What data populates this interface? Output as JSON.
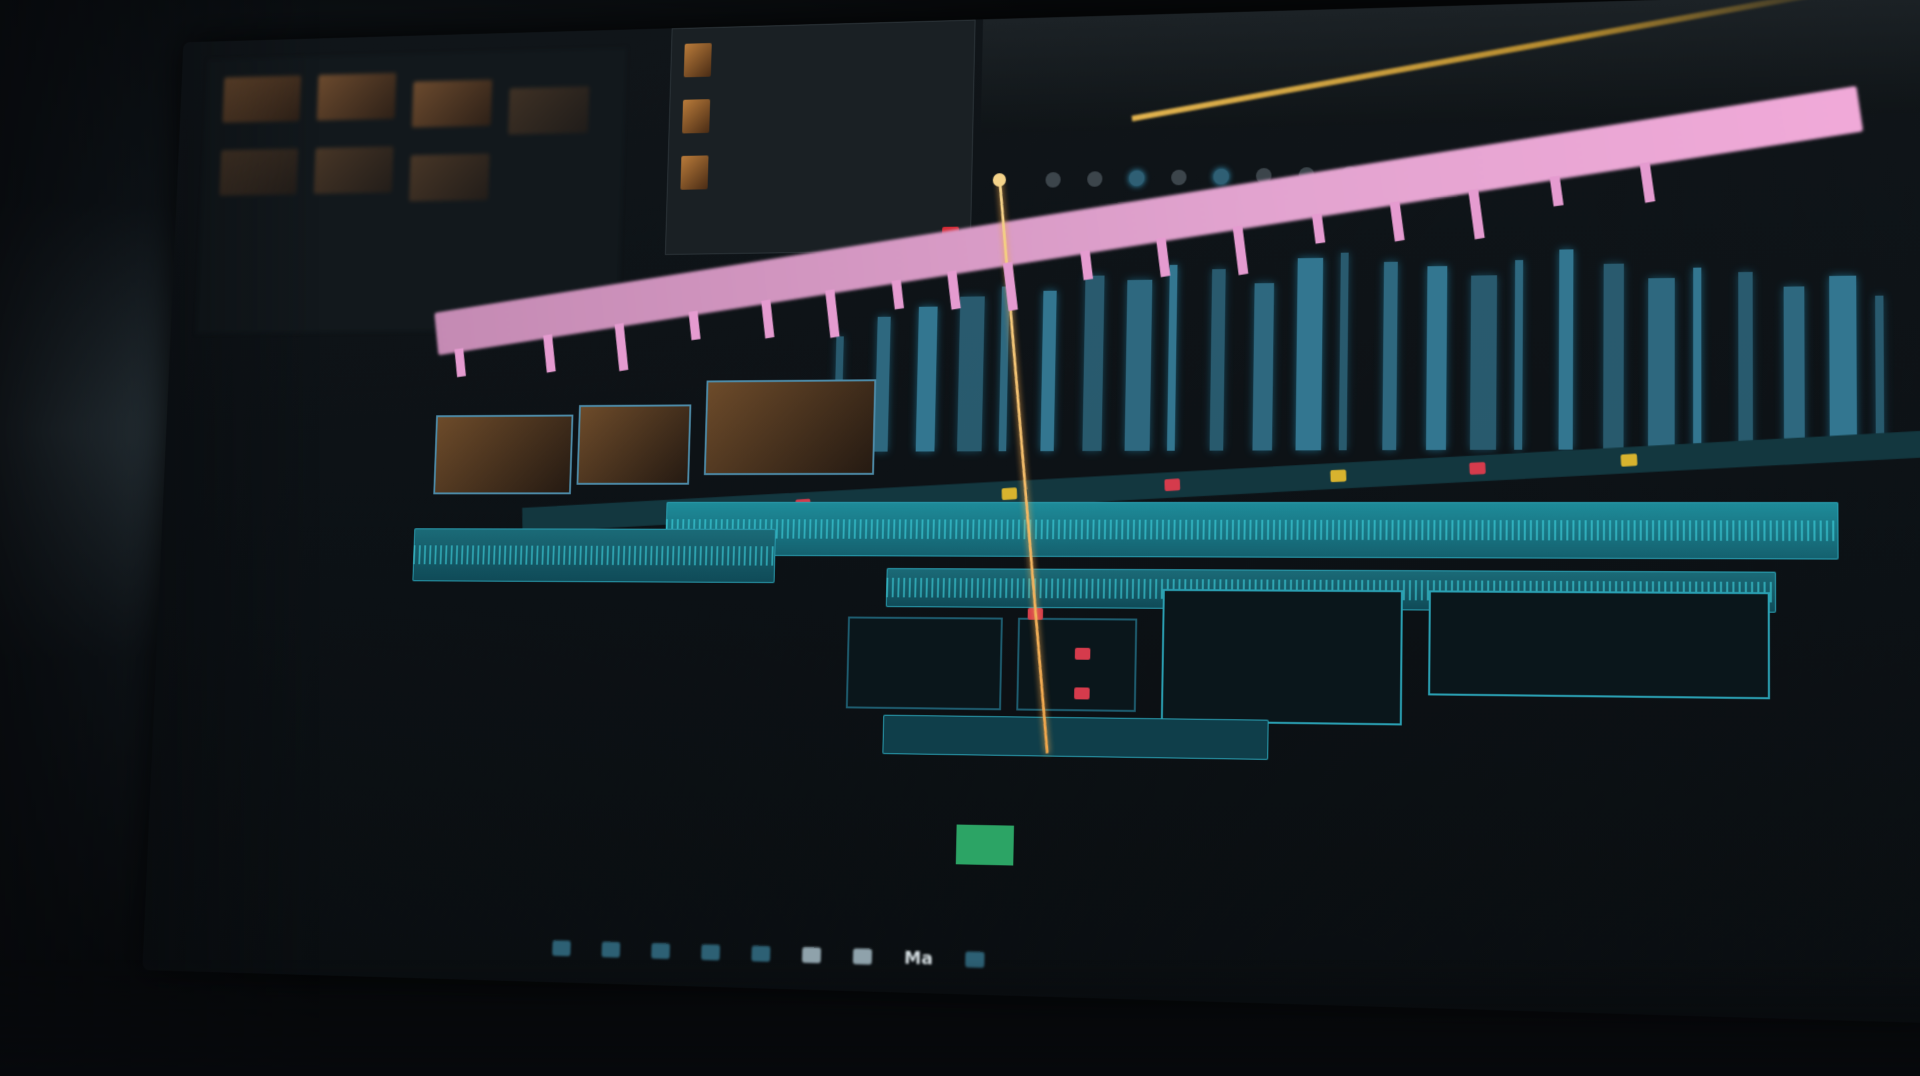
{
  "app": {
    "bottom_label": "Ma"
  },
  "bins": [
    {
      "name": "",
      "meta": ""
    },
    {
      "name": "",
      "meta": ""
    },
    {
      "name": "",
      "meta": ""
    }
  ],
  "timecodes": {
    "playhead": "",
    "ruler": []
  },
  "colors": {
    "background": "#07090c",
    "video_track": "#e2a3cf",
    "audio_track": "#1b6b78",
    "playhead": "#f0a54a",
    "accent_blue": "#4fb8ea",
    "marker_red": "#d53b4c",
    "marker_yellow": "#d8b32e",
    "gold_progress": "#e3b44f"
  },
  "icons": {
    "toolbar": [
      "pointer-icon",
      "trim-icon",
      "blade-icon",
      "snap-icon",
      "link-icon",
      "flag-icon",
      "marker-icon",
      "zoom-icon",
      "settings-icon"
    ],
    "transport": [
      "skip-back-icon",
      "step-back-icon",
      "play-icon",
      "step-forward-icon",
      "skip-forward-icon",
      "loop-icon",
      "volume-icon",
      "fullscreen-icon"
    ]
  }
}
